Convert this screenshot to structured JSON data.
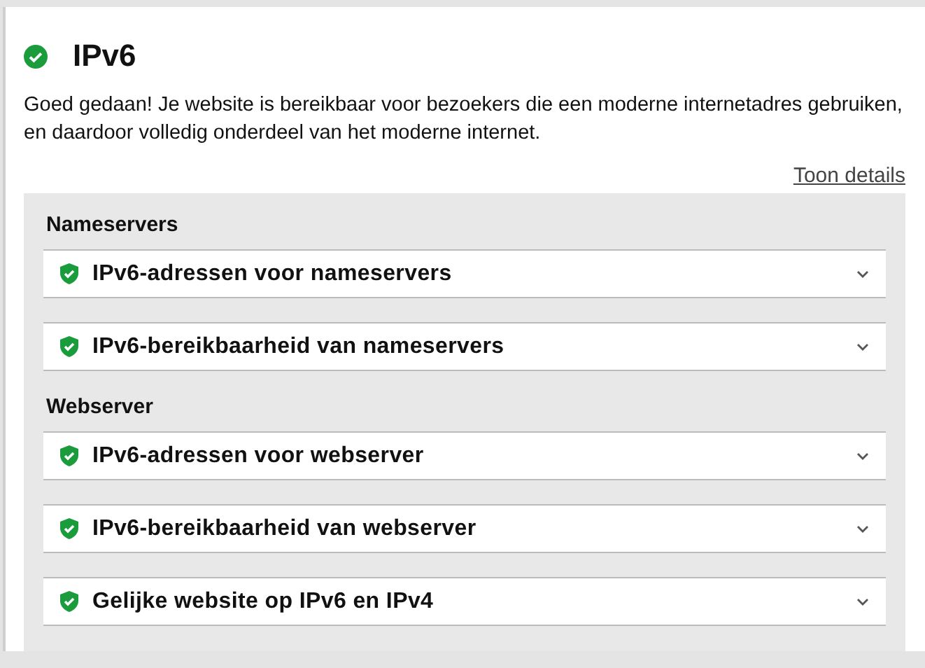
{
  "header": {
    "title": "IPv6",
    "passed": true
  },
  "summary": "Goed gedaan! Je website is bereikbaar voor bezoekers die een moderne internetadres gebruiken, en daardoor volledig onderdeel van het moderne internet.",
  "details_link": "Toon details",
  "sections": [
    {
      "title": "Nameservers",
      "tests": [
        {
          "label": "IPv6-adressen voor nameservers",
          "passed": true,
          "expanded": false
        },
        {
          "label": "IPv6-bereikbaarheid van nameservers",
          "passed": true,
          "expanded": false
        }
      ]
    },
    {
      "title": "Webserver",
      "tests": [
        {
          "label": "IPv6-adressen voor webserver",
          "passed": true,
          "expanded": false
        },
        {
          "label": "IPv6-bereikbaarheid van webserver",
          "passed": true,
          "expanded": false
        },
        {
          "label": "Gelijke website op IPv6 en IPv4",
          "passed": true,
          "expanded": false
        }
      ]
    }
  ]
}
